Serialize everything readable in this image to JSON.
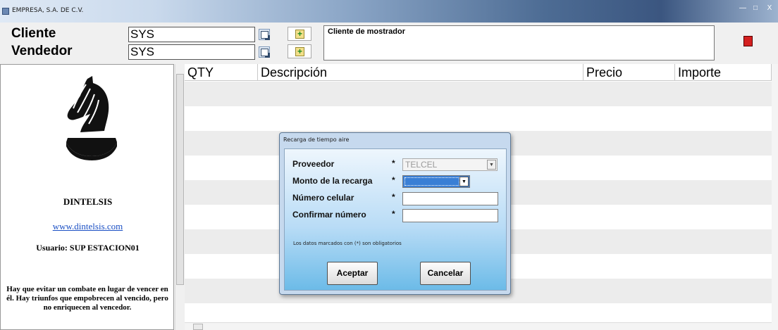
{
  "window": {
    "title": "EMPRESA, S.A. DE C.V.",
    "min_glyph": "—",
    "max_glyph": "□",
    "close_glyph": "X"
  },
  "header": {
    "cliente_label": "Cliente",
    "cliente_value": "SYS",
    "vendedor_label": "Vendedor",
    "vendedor_value": "SYS",
    "description": "Cliente de mostrador",
    "add_glyph": "+"
  },
  "left_panel": {
    "company": "DINTELSIS",
    "website": "www.dintelsis.com",
    "user": "Usuario: SUP ESTACION01",
    "quote": "Hay que evitar un combate en lugar de vencer en él. Hay triunfos que empobrecen al vencido, pero no enriquecen al vencedor."
  },
  "grid": {
    "columns": [
      "QTY",
      "Descripción",
      "Precio",
      "Importe"
    ]
  },
  "dialog": {
    "title": "Recarga de tiempo aire",
    "fields": [
      {
        "label": "Proveedor",
        "value": "TELCEL"
      },
      {
        "label": "Monto de la recarga",
        "value": ""
      },
      {
        "label": "Número celular",
        "value": ""
      },
      {
        "label": "Confirmar número",
        "value": ""
      }
    ],
    "required_marker": "*",
    "note": "Los datos marcados con (*) son obligatorios",
    "accept_label": "Aceptar",
    "cancel_label": "Cancelar"
  },
  "colors": {
    "accent_red": "#d42020",
    "link": "#1a4fc4",
    "row_alt": "#ececec",
    "selection": "#3a7fd5"
  },
  "icons": [
    "app-icon",
    "search-icon",
    "add-icon",
    "logo-horse-icon",
    "dropdown-arrow-icon"
  ]
}
